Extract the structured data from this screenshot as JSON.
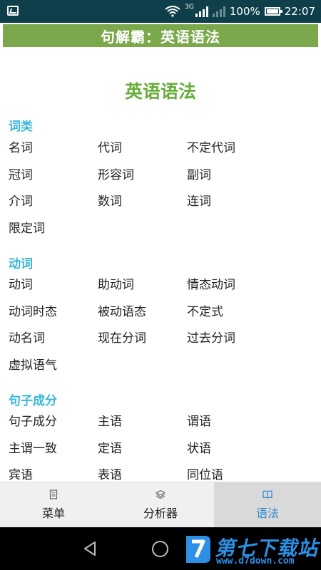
{
  "status_bar": {
    "network": "3G",
    "battery": "100%",
    "time": "22:07"
  },
  "app_bar": {
    "title": "句解霸：英语语法"
  },
  "page": {
    "title": "英语语法",
    "sections": [
      {
        "heading": "词类",
        "rows": [
          [
            "名词",
            "代词",
            "不定代词"
          ],
          [
            "冠词",
            "形容词",
            "副词"
          ],
          [
            "介词",
            "数词",
            "连词"
          ],
          [
            "限定词",
            "",
            ""
          ]
        ]
      },
      {
        "heading": "动词",
        "rows": [
          [
            "动词",
            "助动词",
            "情态动词"
          ],
          [
            "动词时态",
            "被动语态",
            "不定式"
          ],
          [
            "动名词",
            "现在分词",
            "过去分词"
          ],
          [
            "虚拟语气",
            "",
            ""
          ]
        ]
      },
      {
        "heading": "句子成分",
        "rows": [
          [
            "句子成分",
            "主语",
            "谓语"
          ],
          [
            "主谓一致",
            "定语",
            "状语"
          ],
          [
            "宾语",
            "表语",
            "同位语"
          ]
        ]
      }
    ]
  },
  "tabs": [
    {
      "label": "菜单",
      "icon": "menu-doc-icon",
      "active": false
    },
    {
      "label": "分析器",
      "icon": "layers-icon",
      "active": false
    },
    {
      "label": "语法",
      "icon": "book-icon",
      "active": true
    }
  ],
  "watermark": {
    "name": "第七下载站",
    "url": "www.d7down.com"
  },
  "colors": {
    "status_bar": "#0f3f4a",
    "app_bar": "#7aa84a",
    "title_green": "#67ad3c",
    "section_cyan": "#39b7d8",
    "tab_active_text": "#2f86d6"
  }
}
